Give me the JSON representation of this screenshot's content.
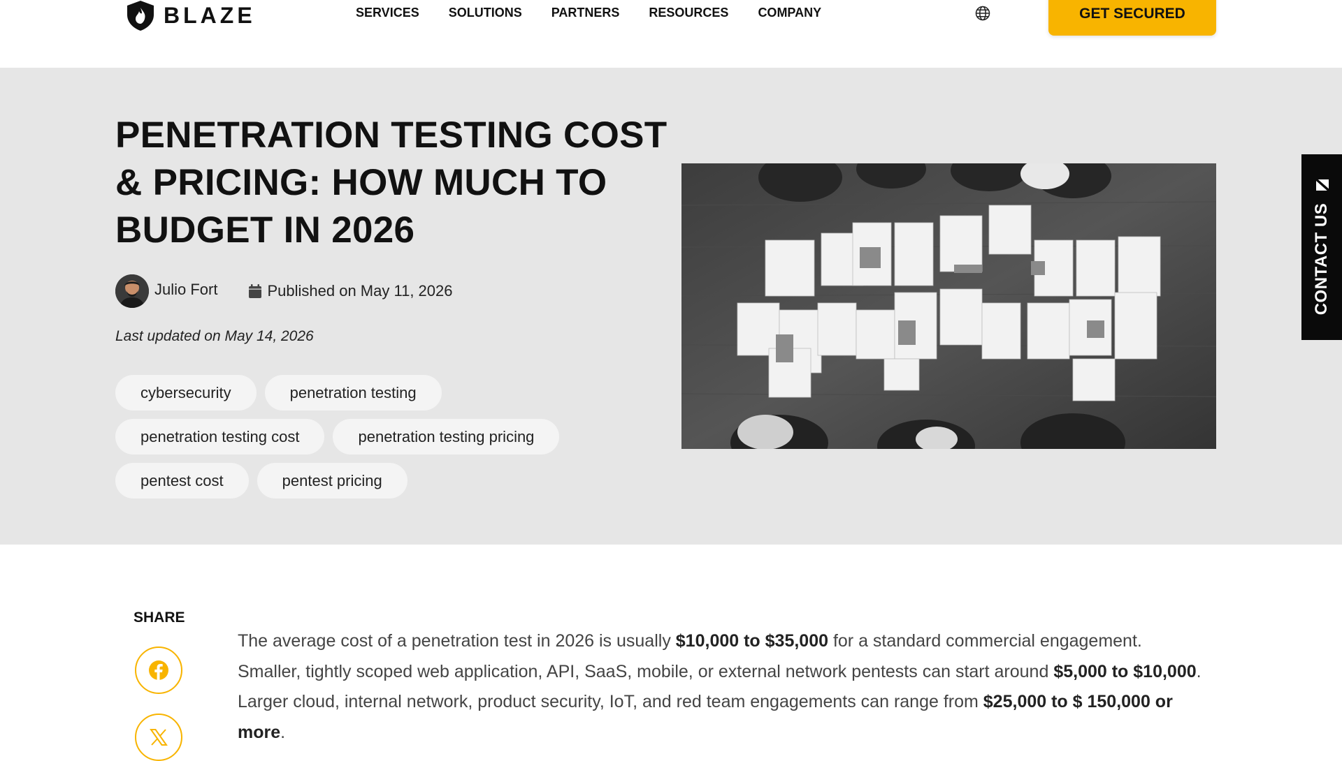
{
  "header": {
    "logo_text": "BLAZE",
    "nav": [
      "SERVICES",
      "SOLUTIONS",
      "PARTNERS",
      "RESOURCES",
      "COMPANY"
    ],
    "cta_label": "GET SECURED",
    "accent_color": "#f8b400"
  },
  "hero": {
    "title": "PENETRATION TESTING COST & PRICING: HOW MUCH TO BUDGET IN 2026",
    "author": "Julio Fort",
    "published": "Published on May 11, 2026",
    "last_updated": "Last updated on May 14, 2026",
    "tags": [
      "cybersecurity",
      "penetration testing",
      "penetration testing cost",
      "penetration testing pricing",
      "pentest cost",
      "pentest pricing"
    ],
    "background": "#e6e6e6"
  },
  "contact_tab": {
    "label": "CONTACT US",
    "icon": "envelope-icon"
  },
  "share": {
    "label": "SHARE",
    "icons": [
      "facebook-icon",
      "x-icon"
    ]
  },
  "article": {
    "p1_a": "The average cost of a penetration test in 2026 is usually ",
    "p1_b": "$10,000 to $35,000",
    "p1_c": " for a standard commercial engagement. Smaller, tightly scoped web application, API, SaaS, mobile, or external network pentests can start around ",
    "p1_d": "$5,000 to $10,000",
    "p1_e": ". Larger cloud, internal network, product security, IoT, and red team engagements can range from ",
    "p1_f": "$25,000 to $ 150,000 or more",
    "p1_g": "."
  }
}
